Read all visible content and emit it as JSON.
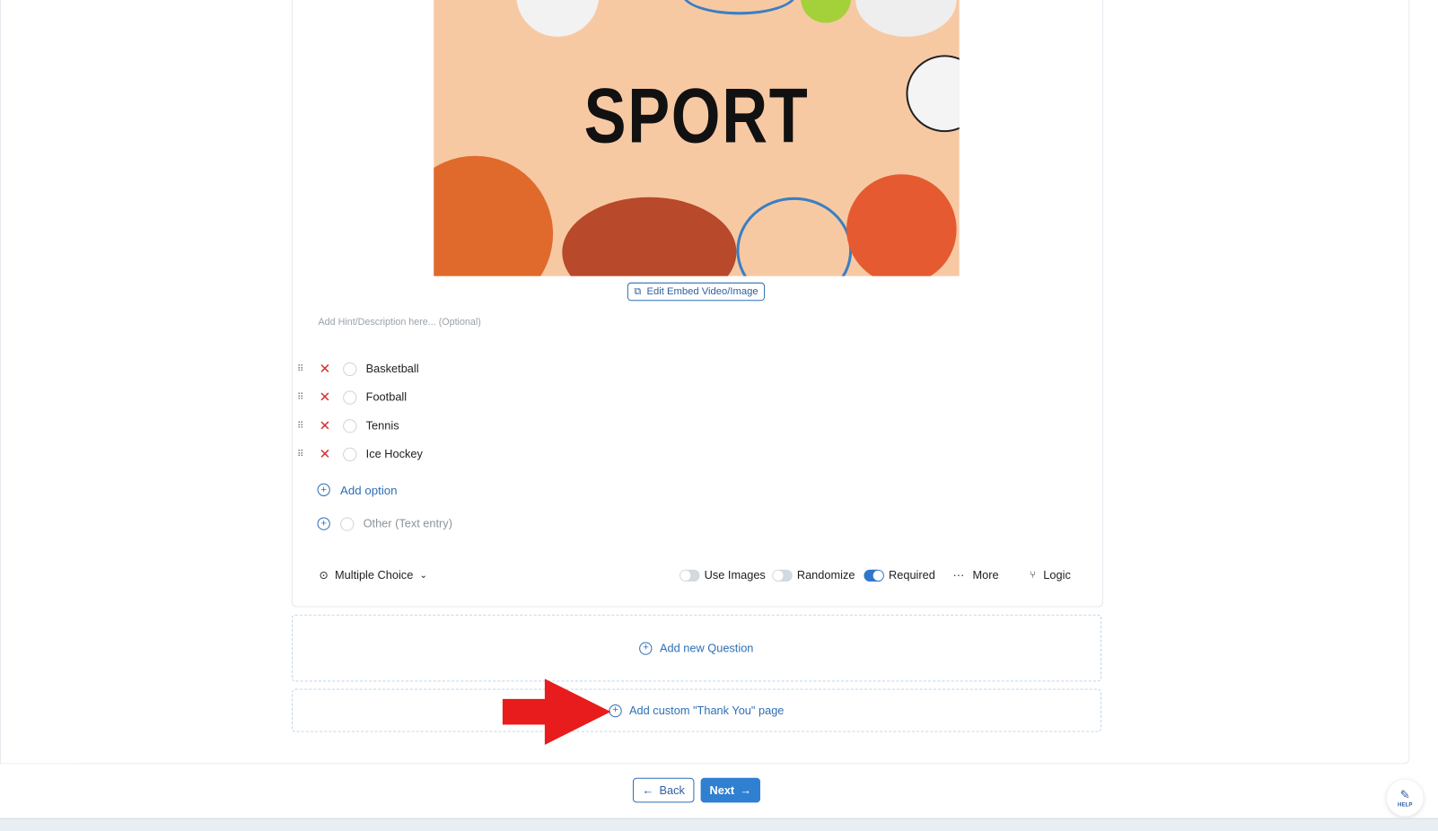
{
  "media": {
    "image_text": "SPORT",
    "edit_button": "Edit Embed Video/Image"
  },
  "question": {
    "hint_placeholder": "Add Hint/Description here... (Optional)",
    "options": [
      {
        "label": "Basketball"
      },
      {
        "label": "Football"
      },
      {
        "label": "Tennis"
      },
      {
        "label": "Ice Hockey"
      }
    ],
    "add_option": "Add option",
    "other_option": "Other (Text entry)"
  },
  "toolbar": {
    "question_type": "Multiple Choice",
    "use_images": {
      "label": "Use Images",
      "on": false
    },
    "randomize": {
      "label": "Randomize",
      "on": false
    },
    "required": {
      "label": "Required",
      "on": true
    },
    "more": "More",
    "logic": "Logic"
  },
  "add_question": "Add new Question",
  "add_thank_you": "Add custom \"Thank You\" page",
  "nav": {
    "back": "Back",
    "next": "Next"
  },
  "help": "HELP",
  "colors": {
    "accent": "#2f77cc",
    "delete": "#d63030",
    "annotation_arrow": "#e81c1c"
  }
}
